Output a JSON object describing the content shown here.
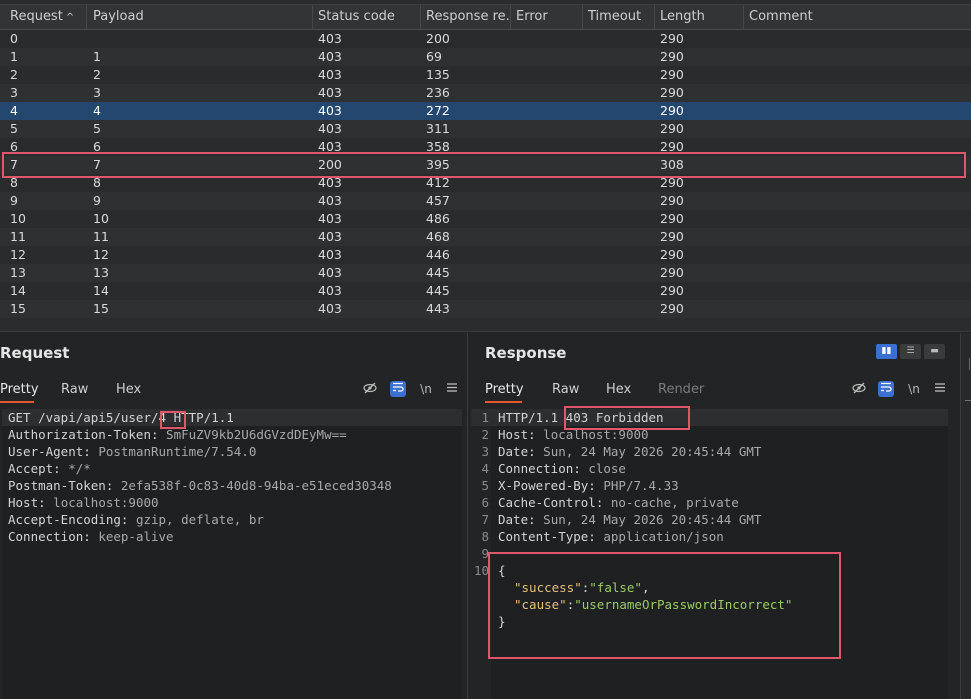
{
  "table": {
    "columns": [
      "Request",
      "Payload",
      "Status code",
      "Response re...",
      "Error",
      "Timeout",
      "Length",
      "Comment"
    ],
    "sort_indicator": "^",
    "rows": [
      {
        "request": "0",
        "payload": "",
        "status": "403",
        "response": "200",
        "error": "",
        "timeout": "",
        "length": "290",
        "comment": ""
      },
      {
        "request": "1",
        "payload": "1",
        "status": "403",
        "response": "69",
        "error": "",
        "timeout": "",
        "length": "290",
        "comment": ""
      },
      {
        "request": "2",
        "payload": "2",
        "status": "403",
        "response": "135",
        "error": "",
        "timeout": "",
        "length": "290",
        "comment": ""
      },
      {
        "request": "3",
        "payload": "3",
        "status": "403",
        "response": "236",
        "error": "",
        "timeout": "",
        "length": "290",
        "comment": ""
      },
      {
        "request": "4",
        "payload": "4",
        "status": "403",
        "response": "272",
        "error": "",
        "timeout": "",
        "length": "290",
        "comment": "",
        "selected": true
      },
      {
        "request": "5",
        "payload": "5",
        "status": "403",
        "response": "311",
        "error": "",
        "timeout": "",
        "length": "290",
        "comment": ""
      },
      {
        "request": "6",
        "payload": "6",
        "status": "403",
        "response": "358",
        "error": "",
        "timeout": "",
        "length": "290",
        "comment": ""
      },
      {
        "request": "7",
        "payload": "7",
        "status": "200",
        "response": "395",
        "error": "",
        "timeout": "",
        "length": "308",
        "comment": ""
      },
      {
        "request": "8",
        "payload": "8",
        "status": "403",
        "response": "412",
        "error": "",
        "timeout": "",
        "length": "290",
        "comment": ""
      },
      {
        "request": "9",
        "payload": "9",
        "status": "403",
        "response": "457",
        "error": "",
        "timeout": "",
        "length": "290",
        "comment": ""
      },
      {
        "request": "10",
        "payload": "10",
        "status": "403",
        "response": "486",
        "error": "",
        "timeout": "",
        "length": "290",
        "comment": ""
      },
      {
        "request": "11",
        "payload": "11",
        "status": "403",
        "response": "468",
        "error": "",
        "timeout": "",
        "length": "290",
        "comment": ""
      },
      {
        "request": "12",
        "payload": "12",
        "status": "403",
        "response": "446",
        "error": "",
        "timeout": "",
        "length": "290",
        "comment": ""
      },
      {
        "request": "13",
        "payload": "13",
        "status": "403",
        "response": "445",
        "error": "",
        "timeout": "",
        "length": "290",
        "comment": ""
      },
      {
        "request": "14",
        "payload": "14",
        "status": "403",
        "response": "445",
        "error": "",
        "timeout": "",
        "length": "290",
        "comment": ""
      },
      {
        "request": "15",
        "payload": "15",
        "status": "403",
        "response": "443",
        "error": "",
        "timeout": "",
        "length": "290",
        "comment": ""
      }
    ]
  },
  "request": {
    "title": "Request",
    "tabs": [
      "Pretty",
      "Raw",
      "Hex"
    ],
    "tools": {
      "eye_off": "eye-off-icon",
      "wrap": "wrap-icon",
      "newline": "\\n",
      "menu": "menu-icon"
    },
    "lines": [
      {
        "a": "GET /vapi/api5/user",
        "b": "/4",
        "c": " HTTP/1.1"
      },
      {
        "k": "Authorization-Token:",
        "v": " SmFuZV9kb2U6dGVzdDEyMw=="
      },
      {
        "k": "User-Agent:",
        "v": " PostmanRuntime/7.54.0"
      },
      {
        "k": "Accept:",
        "v": " */*"
      },
      {
        "k": "Postman-Token:",
        "v": " 2efa538f-0c83-40d8-94ba-e51eced30348"
      },
      {
        "k": "Host:",
        "v": " localhost:9000"
      },
      {
        "k": "Accept-Encoding:",
        "v": " gzip, deflate, br"
      },
      {
        "k": "Connection:",
        "v": " keep-alive"
      }
    ]
  },
  "response": {
    "title": "Response",
    "tabs": [
      "Pretty",
      "Raw",
      "Hex",
      "Render"
    ],
    "tools": {
      "eye_off": "eye-off-icon",
      "wrap": "wrap-icon",
      "newline": "\\n",
      "menu": "menu-icon"
    },
    "lines": [
      {
        "n": "1",
        "a": "HTTP/1.1 ",
        "b": "403 Forbidden"
      },
      {
        "n": "2",
        "k": "Host:",
        "v": " localhost:9000"
      },
      {
        "n": "3",
        "k": "Date:",
        "v": " Sun, 24 May 2026 20:45:44 GMT"
      },
      {
        "n": "4",
        "k": "Connection:",
        "v": " close"
      },
      {
        "n": "5",
        "k": "X-Powered-By:",
        "v": " PHP/7.4.33"
      },
      {
        "n": "6",
        "k": "Cache-Control:",
        "v": " no-cache, private"
      },
      {
        "n": "7",
        "k": "Date:",
        "v": " Sun, 24 May 2026 20:45:44 GMT"
      },
      {
        "n": "8",
        "k": "Content-Type:",
        "v": " application/json"
      },
      {
        "n": "9",
        "k": "",
        "v": ""
      },
      {
        "n": "10",
        "k": "{",
        "v": ""
      }
    ],
    "json": {
      "success_key": "\"success\"",
      "success_val": "\"false\"",
      "cause_key": "\"cause\"",
      "cause_val": "\"usernameOrPasswordIncorrect\"",
      "close": "}"
    }
  },
  "colors": {
    "accent": "#e2572c",
    "selected_row": "#24476f",
    "highlight_box": "#e0566b",
    "toggle_on": "#3b6fd2"
  }
}
